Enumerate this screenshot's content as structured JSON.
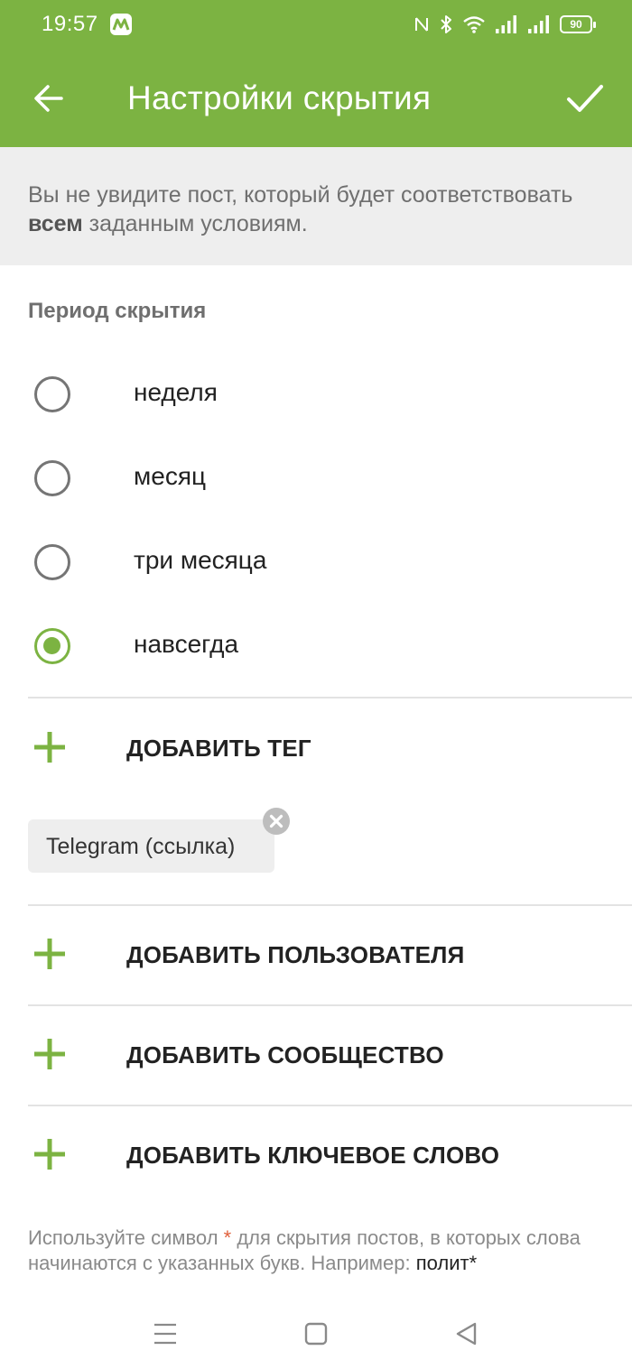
{
  "status_bar": {
    "time": "19:57",
    "battery": "90",
    "icons": [
      "app-notification-icon",
      "nfc-icon",
      "bluetooth-icon",
      "wifi-icon",
      "signal-icon",
      "signal-icon",
      "battery-icon"
    ]
  },
  "app_bar": {
    "title": "Настройки скрытия",
    "back_icon": "arrow-left-icon",
    "confirm_icon": "check-icon",
    "color": "#7cb342"
  },
  "info": {
    "text_before": "Вы не увидите пост, который будет соответствовать ",
    "text_bold": "всем",
    "text_after": " заданным условиям."
  },
  "period": {
    "title": "Период скрытия",
    "options": [
      {
        "label": "неделя",
        "checked": false
      },
      {
        "label": "месяц",
        "checked": false
      },
      {
        "label": "три месяца",
        "checked": false
      },
      {
        "label": "навсегда",
        "checked": true
      }
    ]
  },
  "actions": {
    "add_tag": "ДОБАВИТЬ ТЕГ",
    "add_user": "ДОБАВИТЬ ПОЛЬЗОВАТЕЛЯ",
    "add_community": "ДОБАВИТЬ СООБЩЕСТВО",
    "add_keyword": "ДОБАВИТЬ КЛЮЧЕВОЕ СЛОВО"
  },
  "tags": [
    {
      "label": "Telegram (ссылка)"
    }
  ],
  "hint": {
    "before": "Используйте символ ",
    "star": "*",
    "after": " для скрытия постов, в которых слова начинаются с указанных букв. Например: ",
    "example": "полит*"
  },
  "colors": {
    "accent": "#7cb342",
    "banner": "#eeeeee",
    "star": "#e0603c"
  }
}
